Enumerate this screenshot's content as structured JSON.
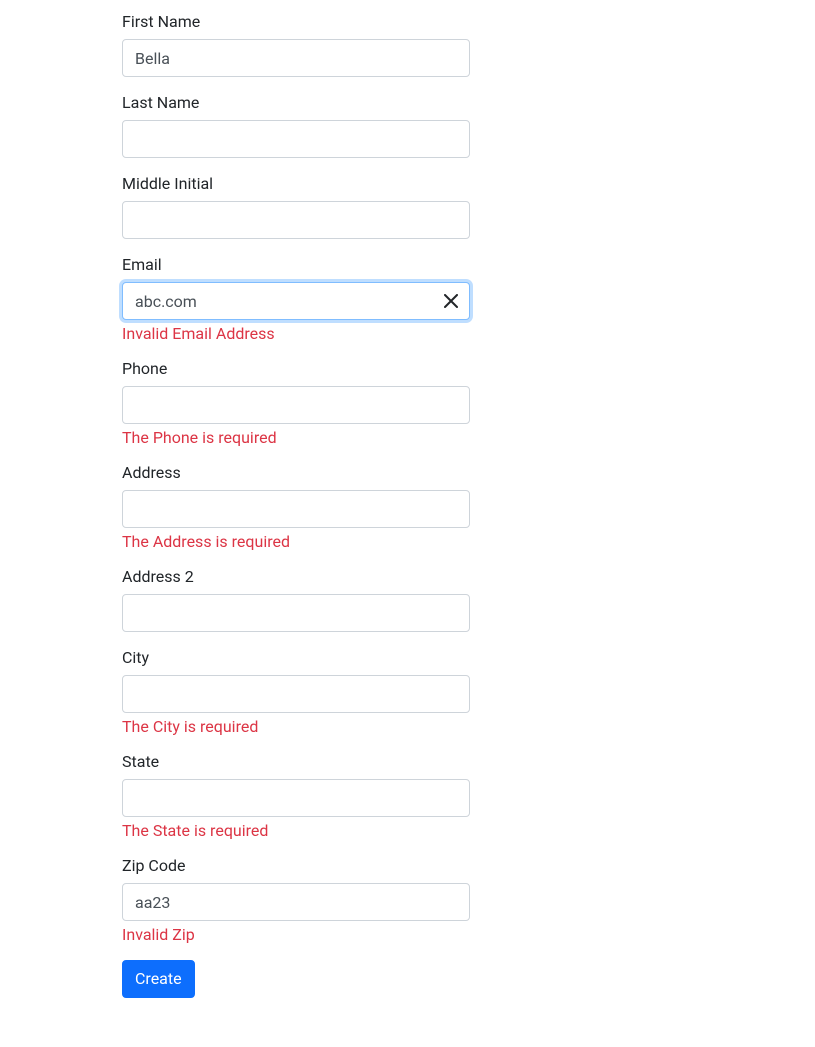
{
  "form": {
    "firstName": {
      "label": "First Name",
      "value": "Bella",
      "error": ""
    },
    "lastName": {
      "label": "Last Name",
      "value": "",
      "error": ""
    },
    "middleInitial": {
      "label": "Middle Initial",
      "value": "",
      "error": ""
    },
    "email": {
      "label": "Email",
      "value": "abc.com",
      "error": "Invalid Email Address"
    },
    "phone": {
      "label": "Phone",
      "value": "",
      "error": "The Phone is required"
    },
    "address": {
      "label": "Address",
      "value": "",
      "error": "The Address is required"
    },
    "address2": {
      "label": "Address 2",
      "value": "",
      "error": ""
    },
    "city": {
      "label": "City",
      "value": "",
      "error": "The City is required"
    },
    "state": {
      "label": "State",
      "value": "",
      "error": "The State is required"
    },
    "zipCode": {
      "label": "Zip Code",
      "value": "aa23",
      "error": "Invalid Zip"
    }
  },
  "buttons": {
    "create": "Create"
  }
}
